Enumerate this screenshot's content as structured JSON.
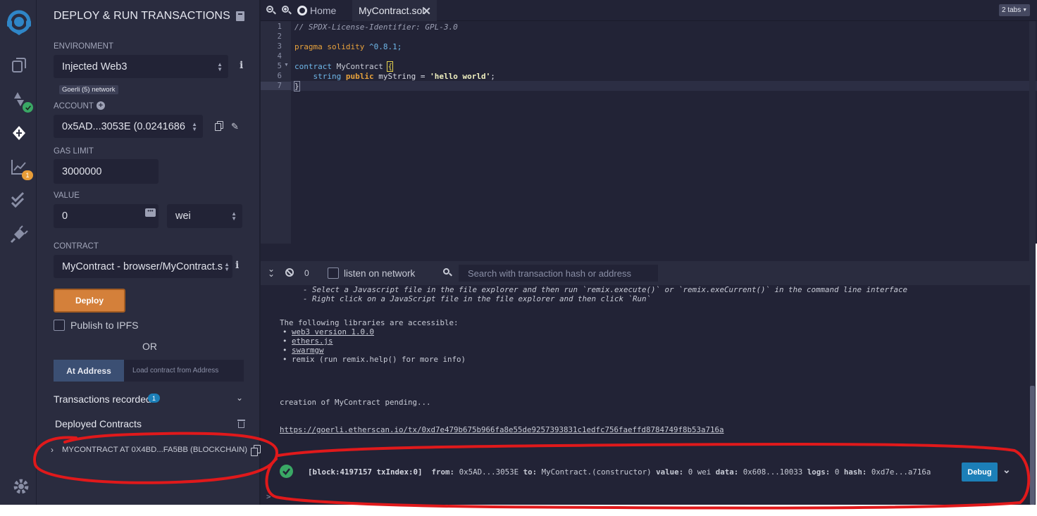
{
  "panel": {
    "title": "DEPLOY & RUN TRANSACTIONS",
    "environment_label": "ENVIRONMENT",
    "environment_value": "Injected Web3",
    "network_badge": "Goerli (5) network",
    "account_label": "ACCOUNT",
    "account_value": "0x5AD...3053E (0.0241686",
    "gas_limit_label": "GAS LIMIT",
    "gas_limit_value": "3000000",
    "value_label": "VALUE",
    "value_value": "0",
    "value_unit": "wei",
    "contract_label": "CONTRACT",
    "contract_value": "MyContract - browser/MyContract.s",
    "deploy_label": "Deploy",
    "publish_label": "Publish to IPFS",
    "or_label": "OR",
    "at_address_label": "At Address",
    "at_address_placeholder": "Load contract from Address",
    "transactions_label": "Transactions recorded",
    "transactions_count": "1",
    "deployed_label": "Deployed Contracts",
    "deployed_item": "MYCONTRACT AT 0X4BD...FA5BB (BLOCKCHAIN)"
  },
  "rail": {
    "pending_badge": "1"
  },
  "tabs": {
    "home": "Home",
    "active": "MyContract.sol",
    "tabs_count": "2 tabs"
  },
  "editor": {
    "line_numbers": [
      "1",
      "2",
      "3",
      "4",
      "5",
      "6",
      "7"
    ],
    "line1": "// SPDX-License-Identifier: GPL-3.0",
    "line3_kw": "pragma solidity",
    "line3_ver": "^0.8.1;",
    "line5_kw": "contract",
    "line5_name": "MyContract",
    "line5_brace": "{",
    "line6_type": "string",
    "line6_kw": "public",
    "line6_rest": "myString =",
    "line6_str": "'hello world'",
    "line6_end": ";",
    "line7": "}"
  },
  "terminal": {
    "pending_count": "0",
    "listen_label": "listen on network",
    "search_placeholder": "Search with transaction hash or address",
    "hint1": "- Select a Javascript file in the file explorer and then run `remix.execute()` or `remix.exeCurrent()` in the command line interface",
    "hint2": "- Right click on a JavaScript file in the file explorer and then click `Run`",
    "libs_title": "The following libraries are accessible:",
    "lib1": "web3 version 1.0.0",
    "lib2": "ethers.js",
    "lib3": "swarmgw",
    "lib4": "remix (run remix.help() for more info)",
    "pending_msg": "creation of MyContract pending...",
    "tx_link": "https://goerli.etherscan.io/tx/0xd7e479b675b966fa8e55de9257393831c1edfc756faeffd8784749f8b53a716a",
    "tx_block": "[block:4197157 txIndex:0]",
    "tx_from_label": "from:",
    "tx_from": "0x5AD...3053E",
    "tx_to_label": "to:",
    "tx_to": "MyContract.(constructor)",
    "tx_value_label": "value:",
    "tx_value": "0 wei",
    "tx_data_label": "data:",
    "tx_data": "0x608...10033",
    "tx_logs_label": "logs:",
    "tx_logs": "0",
    "tx_hash_label": "hash:",
    "tx_hash": "0xd7e...a716a",
    "debug_label": "Debug",
    "prompt": ">"
  },
  "colors": {
    "accent": "#d4803a",
    "primary": "#1c7fb8",
    "success": "#3aa865",
    "annotation": "#e0191b"
  }
}
